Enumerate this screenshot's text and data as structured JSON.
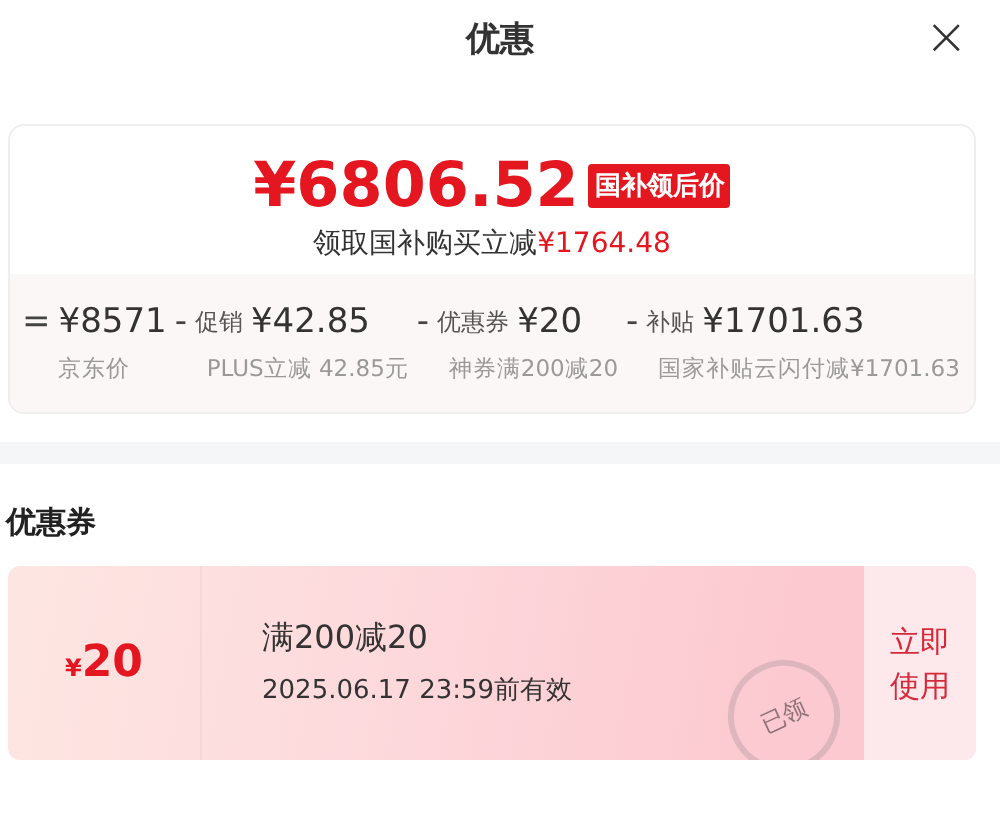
{
  "header": {
    "title": "优惠",
    "close": "×"
  },
  "price": {
    "amount": "¥6806.52",
    "badge": "国补领后价",
    "subtitle": "领取国补购买立减",
    "saving": "¥1764.48"
  },
  "breakdown": [
    {
      "op": "=",
      "amount": "¥8571",
      "note": "京东价"
    },
    {
      "op": "-",
      "name": "促销",
      "amount": "¥42.85",
      "note": "PLUS立减 42.85元"
    },
    {
      "op": "-",
      "name": "优惠券",
      "amount": "¥20",
      "note": "神券满200减20"
    },
    {
      "op": "-",
      "name": "补贴",
      "amount": "¥1701.63",
      "note": "国家补贴云闪付减¥1701.63"
    }
  ],
  "coupons_title": "优惠券",
  "coupons": [
    {
      "currency": "¥",
      "value": "20",
      "condition": "满200减20",
      "validity": "2025.06.17 23:59前有效",
      "action": "立即使用",
      "stamp": "已领"
    }
  ]
}
